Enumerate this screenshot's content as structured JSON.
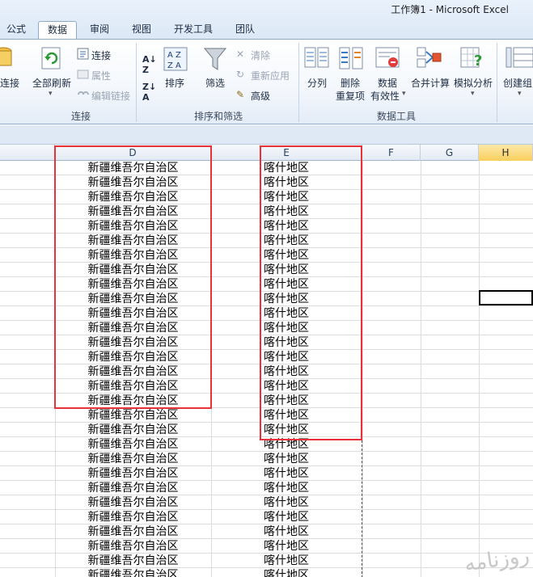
{
  "window": {
    "title": "工作簿1 - Microsoft Excel"
  },
  "tabs": [
    {
      "label": "公式"
    },
    {
      "label": "数据"
    },
    {
      "label": "审阅"
    },
    {
      "label": "视图"
    },
    {
      "label": "开发工具"
    },
    {
      "label": "团队"
    }
  ],
  "ribbon": {
    "connections": {
      "label": "连接",
      "connect_partial": "连接",
      "refresh_all": "全部刷新",
      "connections": "连接",
      "properties": "属性",
      "edit_links": "编辑链接"
    },
    "sort_filter": {
      "label": "排序和筛选",
      "sort": "排序",
      "filter": "筛选",
      "clear": "清除",
      "reapply": "重新应用",
      "advanced": "高级"
    },
    "data_tools": {
      "label": "数据工具",
      "text_to_columns": "分列",
      "remove_duplicates_1": "删除",
      "remove_duplicates_2": "重复项",
      "data_validation_1": "数据",
      "data_validation_2": "有效性",
      "consolidate": "合并计算",
      "what_if": "模拟分析"
    },
    "outline": {
      "group_partial": "创建组"
    }
  },
  "columns": [
    {
      "letter": "D"
    },
    {
      "letter": "E"
    },
    {
      "letter": "F"
    },
    {
      "letter": "G"
    },
    {
      "letter": "H"
    }
  ],
  "rows": [
    {
      "d": "新疆维吾尔自治区",
      "e": "喀什地区"
    },
    {
      "d": "新疆维吾尔自治区",
      "e": "喀什地区"
    },
    {
      "d": "新疆维吾尔自治区",
      "e": "喀什地区"
    },
    {
      "d": "新疆维吾尔自治区",
      "e": "喀什地区"
    },
    {
      "d": "新疆维吾尔自治区",
      "e": "喀什地区"
    },
    {
      "d": "新疆维吾尔自治区",
      "e": "喀什地区"
    },
    {
      "d": "新疆维吾尔自治区",
      "e": "喀什地区"
    },
    {
      "d": "新疆维吾尔自治区",
      "e": "喀什地区"
    },
    {
      "d": "新疆维吾尔自治区",
      "e": "喀什地区"
    },
    {
      "d": "新疆维吾尔自治区",
      "e": "喀什地区"
    },
    {
      "d": "新疆维吾尔自治区",
      "e": "喀什地区"
    },
    {
      "d": "新疆维吾尔自治区",
      "e": "喀什地区"
    },
    {
      "d": "新疆维吾尔自治区",
      "e": "喀什地区"
    },
    {
      "d": "新疆维吾尔自治区",
      "e": "喀什地区"
    },
    {
      "d": "新疆维吾尔自治区",
      "e": "喀什地区"
    },
    {
      "d": "新疆维吾尔自治区",
      "e": "喀什地区"
    },
    {
      "d": "新疆维吾尔自治区",
      "e": "喀什地区"
    },
    {
      "d": "新疆维吾尔自治区",
      "e": "喀什地区"
    },
    {
      "d": "新疆维吾尔自治区",
      "e": "喀什地区"
    },
    {
      "d": "新疆维吾尔自治区",
      "e": "喀什地区"
    },
    {
      "d": "新疆维吾尔自治区",
      "e": "喀什地区"
    },
    {
      "d": "新疆维吾尔自治区",
      "e": "喀什地区"
    },
    {
      "d": "新疆维吾尔自治区",
      "e": "喀什地区"
    },
    {
      "d": "新疆维吾尔自治区",
      "e": "喀什地区"
    },
    {
      "d": "新疆维吾尔自治区",
      "e": "喀什地区"
    },
    {
      "d": "新疆维吾尔自治区",
      "e": "喀什地区"
    },
    {
      "d": "新疆维吾尔自治区",
      "e": "喀什地区"
    },
    {
      "d": "新疆维吾尔自治区",
      "e": "喀什地区"
    },
    {
      "d": "新疆维吾尔自治区",
      "e": "喀什地区"
    }
  ],
  "watermark": {
    "text": "روزنامه"
  },
  "colors": {
    "highlight_box": "#e8323a",
    "selected_header": "#f8cf5d",
    "ribbon_border": "#8fa9c9"
  }
}
